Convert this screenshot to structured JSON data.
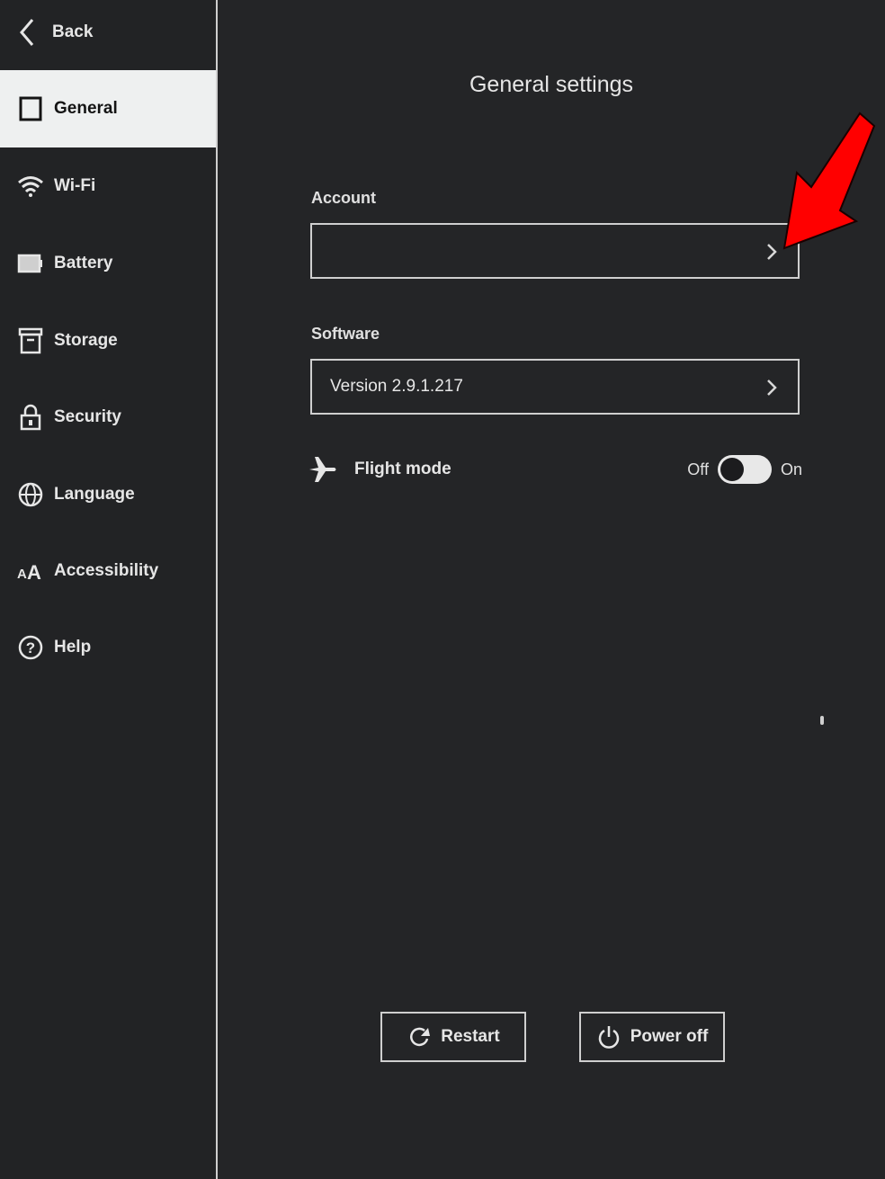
{
  "sidebar": {
    "back_label": "Back",
    "items": [
      {
        "label": "General",
        "icon": "tablet-icon",
        "active": true
      },
      {
        "label": "Wi-Fi",
        "icon": "wifi-icon",
        "active": false
      },
      {
        "label": "Battery",
        "icon": "battery-icon",
        "active": false
      },
      {
        "label": "Storage",
        "icon": "storage-icon",
        "active": false
      },
      {
        "label": "Security",
        "icon": "lock-icon",
        "active": false
      },
      {
        "label": "Language",
        "icon": "globe-icon",
        "active": false
      },
      {
        "label": "Accessibility",
        "icon": "text-size-icon",
        "active": false
      },
      {
        "label": "Help",
        "icon": "help-icon",
        "active": false
      }
    ]
  },
  "main": {
    "title": "General settings",
    "account": {
      "label": "Account",
      "value": ""
    },
    "software": {
      "label": "Software",
      "value": "Version 2.9.1.217"
    },
    "flight_mode": {
      "label": "Flight mode",
      "off_label": "Off",
      "on_label": "On",
      "state": "off"
    },
    "buttons": {
      "restart": "Restart",
      "power_off": "Power off"
    }
  },
  "annotation": {
    "type": "arrow",
    "color": "#ff0000",
    "points_to": "account-field-chevron"
  }
}
